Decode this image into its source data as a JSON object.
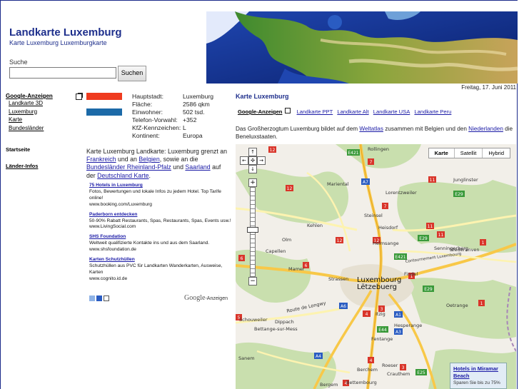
{
  "header": {
    "title": "Landkarte Luxemburg",
    "tagline": "Karte Luxemburg Luxemburgkarte",
    "search_label": "Suche",
    "search_button": "Suchen",
    "date": "Freitag, 17. Juni 2011"
  },
  "sidebar": {
    "heading": "Google-Anzeigen",
    "items": [
      "Landkarte 3D",
      "Luxemburg",
      "Karte",
      "Bundesländer"
    ],
    "startseite": "Startseite",
    "laender": "Länder-Infos"
  },
  "facts": [
    {
      "key": "Hauptstadt:",
      "value": "Luxemburg"
    },
    {
      "key": "Fläche:",
      "value": "2586 qkm"
    },
    {
      "key": "Einwohner:",
      "value": "502 tsd."
    },
    {
      "key": "Telefon-Vorwahl:",
      "value": "+352"
    },
    {
      "key": "KfZ-Kennzeichen:",
      "value": "L"
    },
    {
      "key": "Kontinent:",
      "value": "Europa"
    }
  ],
  "description": {
    "part1": "Karte Luxemburg Landkarte: Luxemburg grenzt an ",
    "link_frankreich": "Frankreich",
    "part2": " und an ",
    "link_belgien": "Belgien",
    "part3": ", sowie an die ",
    "link_bundeslaender": "Bundesländer Rheinland-Pfalz",
    "part4": " und ",
    "link_saarland": "Saarland",
    "part5": " auf der ",
    "link_deutschland": "Deutschland Karte",
    "part6": "."
  },
  "ads": [
    {
      "title": "75 Hotels in Luxemburg",
      "text": "Fotos, Bewertungen und lokale Infos zu jedem Hotel. Top Tarife online!",
      "url": "www.booking.com/Luxemburg"
    },
    {
      "title": "Paderborn entdecken",
      "text": "50-90% Rabatt Restaurants, Spas, Restaurants, Spas, Events usw.!",
      "url": "www.LivingSocial.com"
    },
    {
      "title": "SHS Foundation",
      "text": "Weltweit qualifizierte Kontakte ins und aus dem Saarland.",
      "url": "www.shsfoundation.de"
    },
    {
      "title": "Karten Schutzhüllen",
      "text": "Schutzhüllen aus PVC für Landkarten Wanderkarten, Ausweise, Karten",
      "url": "www.cognito.id.de"
    }
  ],
  "google_ads_brand": "Google",
  "google_ads_label": "-Anzeigen",
  "main": {
    "title": "Karte Luxemburg",
    "links_heading": "Google-Anzeigen",
    "links": [
      "Landkarte PPT",
      "Landkarte Alt",
      "Landkarte USA",
      "Landkarte Peru"
    ],
    "desc_part1": "Das Großherzogtum Luxemburg bildet auf dem ",
    "desc_link1": "Weltatlas",
    "desc_part2": " zusammen mit Belgien und den ",
    "desc_link2": "Niederlanden",
    "desc_part3": " die Beneluxstaaten."
  },
  "map": {
    "types": [
      "Karte",
      "Satellit",
      "Hybrid"
    ],
    "labels": [
      "Rollingen",
      "Mariental",
      "Lorentzweiler",
      "Junglinster",
      "Steinsel",
      "Kehlen",
      "Heisdorf",
      "Olm",
      "Helmsange",
      "Senningerberg",
      "Niederanven",
      "Capellen",
      "Mamer",
      "Strassen",
      "Luxembourg",
      "Lëtzebuerg",
      "Findel",
      "Route de Longwy",
      "Schouweiler",
      "Dippach",
      "Hesperange",
      "Oetrange",
      "Bettange-sur-Mess",
      "Itzig",
      "Fentange",
      "Sanem",
      "Roeser",
      "Berchem",
      "Crauthem",
      "Bettembourg",
      "Bergem",
      "Contournement Luxembourg"
    ],
    "info_title": "Hotels in Miramar Beach",
    "info_text": "Sparen Sie bis zu 75%"
  }
}
